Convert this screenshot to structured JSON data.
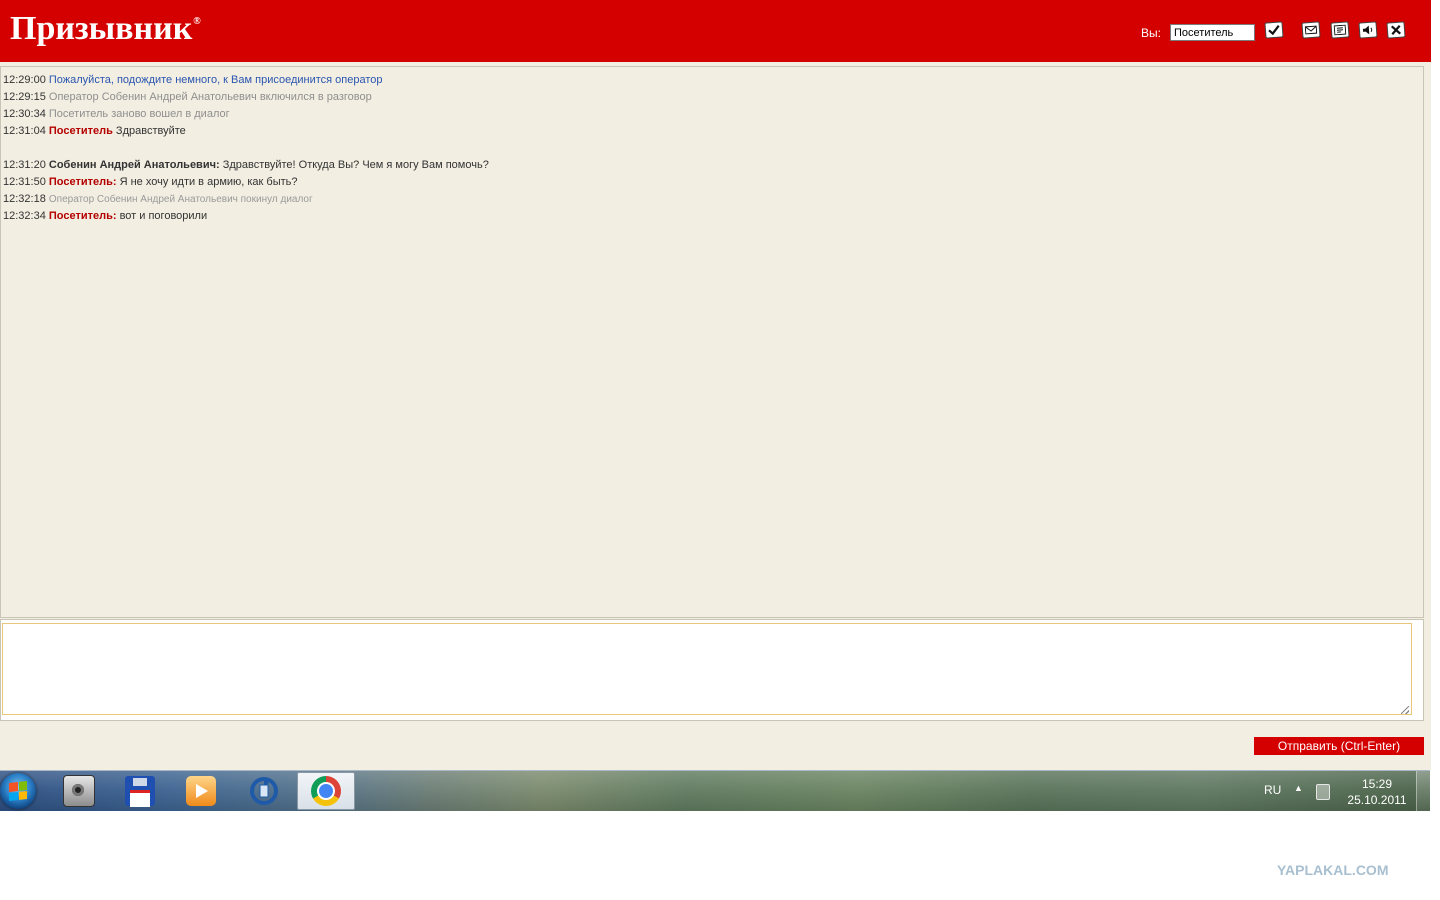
{
  "header": {
    "logo_text": "Призывник",
    "logo_mark": "®",
    "you_label": "Вы:",
    "name_value": "Посетитель",
    "icons": [
      "checkmark-icon",
      "mail-icon",
      "history-icon",
      "sound-icon",
      "close-icon"
    ]
  },
  "messages": [
    {
      "time": "12:29:00",
      "kind": "system",
      "body": "Пожалуйста, подождите немного, к Вам присоединится оператор"
    },
    {
      "time": "12:29:15",
      "kind": "info",
      "body": "Оператор Собенин Андрей Анатольевич включился в разговор"
    },
    {
      "time": "12:30:34",
      "kind": "info",
      "body": "Посетитель заново вошел в диалог"
    },
    {
      "time": "12:31:04",
      "kind": "visitor",
      "who": "Посетитель",
      "text": " Здравствуйте"
    },
    {
      "time": "12:31:20",
      "kind": "operator",
      "who": "Собенин Андрей Анатольевич:",
      "text": " Здравствуйте! Откуда Вы? Чем я могу Вам помочь?"
    },
    {
      "time": "12:31:50",
      "kind": "visitor",
      "who": "Посетитель:",
      "text": " Я не хочу идти в армию, как быть?"
    },
    {
      "time": "12:32:18",
      "kind": "info-small",
      "body": "Оператор Собенин Андрей Анатольевич покинул диалог"
    },
    {
      "time": "12:32:34",
      "kind": "visitor",
      "who": "Посетитель:",
      "text": " вот и поговорили"
    }
  ],
  "compose": {
    "value": "",
    "placeholder": ""
  },
  "send_button_label": "Отправить (Ctrl-Enter)",
  "taskbar": {
    "apps": [
      "speaker-app-icon",
      "save-app-icon",
      "media-app-icon",
      "sync-app-icon",
      "chrome-icon"
    ],
    "language": "RU",
    "time": "15:29",
    "date": "25.10.2011"
  },
  "watermark": "YAPLAKAL.COM",
  "colors": {
    "brand_red": "#d40000",
    "log_bg": "#f2eee2",
    "system_blue": "#2a55b0",
    "visitor_red": "#b40000"
  }
}
